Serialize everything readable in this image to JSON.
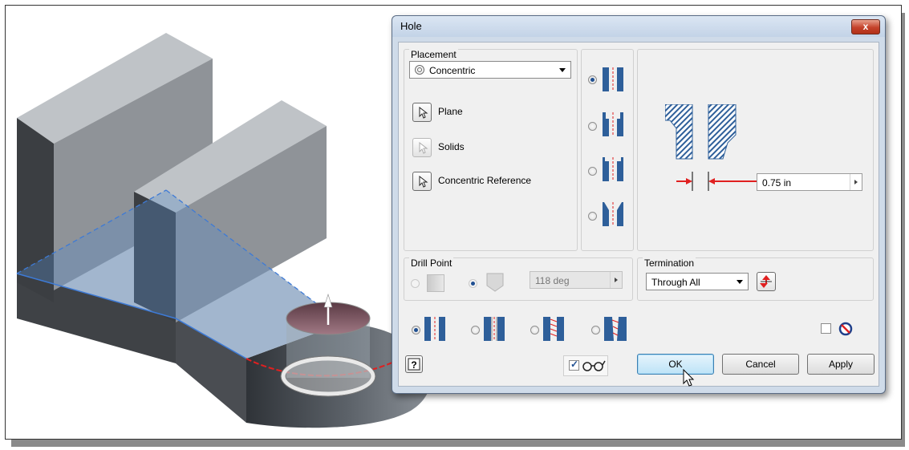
{
  "window": {
    "title": "Hole",
    "close_glyph": "x"
  },
  "placement": {
    "group_label": "Placement",
    "type_value": "Concentric",
    "type_icon": "concentric-circle-icon",
    "selectors": [
      {
        "label": "Plane",
        "icon": "cursor-arrow-icon",
        "enabled": true
      },
      {
        "label": "Solids",
        "icon": "cursor-arrow-icon",
        "enabled": false
      },
      {
        "label": "Concentric Reference",
        "icon": "cursor-arrow-icon",
        "enabled": true
      }
    ]
  },
  "hole_types": {
    "selected_index": 0,
    "options": [
      "simple",
      "counterbore",
      "spotface",
      "countersink"
    ]
  },
  "preview": {
    "diameter_value": "0.75 in",
    "accent_color": "#e02020",
    "hatch_color": "#2e5f9a"
  },
  "drill_point": {
    "group_label": "Drill Point",
    "options": [
      "flat",
      "angle"
    ],
    "selected_index": 1,
    "angle_value": "118 deg",
    "enabled": false
  },
  "termination": {
    "group_label": "Termination",
    "value": "Through All",
    "flip_icon": "flip-direction-icon"
  },
  "thread_types": {
    "selected_index": 0,
    "options": [
      "drilled",
      "clearance",
      "tapped",
      "taper-tapped"
    ]
  },
  "infer_icon": "no-icon",
  "buttons": {
    "ok": "OK",
    "cancel": "Cancel",
    "apply": "Apply"
  },
  "help_icon": "help-icon",
  "preview_checkbox": {
    "checked": true,
    "icon": "glasses-icon"
  }
}
